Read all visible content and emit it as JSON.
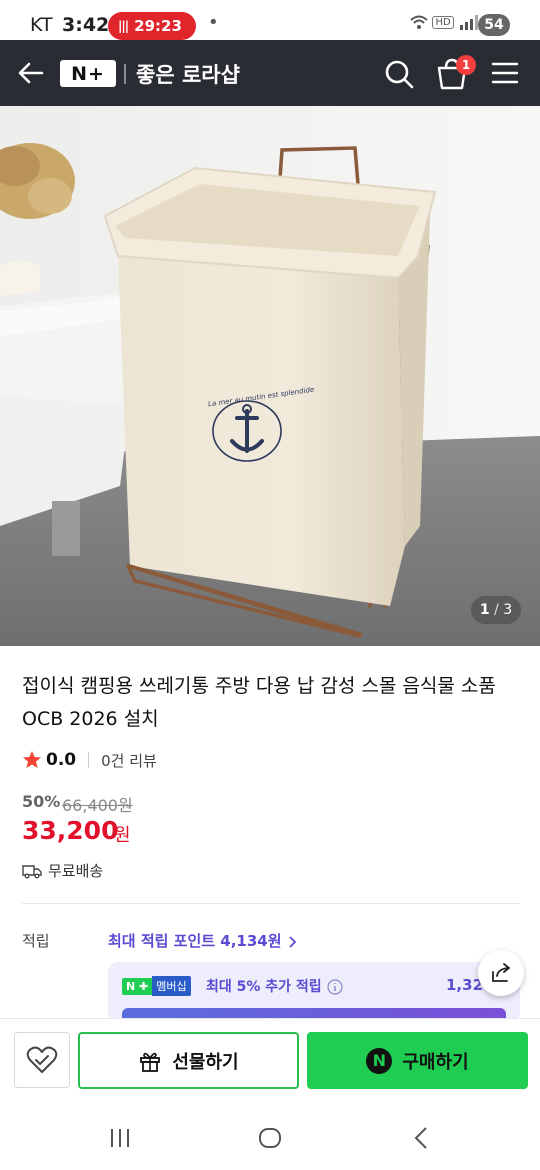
{
  "status_bar": {
    "carrier": "KT",
    "time": "3:42",
    "recording_time": "29:23",
    "dot": "•",
    "network": "HD",
    "battery": "54"
  },
  "header": {
    "logo": "N+",
    "store_name": "좋은 로라샵",
    "cart_count": "1"
  },
  "product": {
    "image_counter": {
      "current": "1",
      "total": "3"
    },
    "title": "접이식 캠핑용 쓰레기통 주방 다용 납 감성 스몰 음식물 소품 OCB 2026 설치",
    "rating": "0.0",
    "review_count": "0건 리뷰",
    "discount_rate": "50%",
    "original_price": "66,400원",
    "sale_price": "33,200",
    "price_unit": "원",
    "shipping": "무료배송",
    "bag_print": "La mer au mutin est splendide"
  },
  "points": {
    "label": "적립",
    "max_points": "최대 적립 포인트 4,134원",
    "membership_badge": "멤버십",
    "membership_text": "최대 5% 추가 적립",
    "membership_amount": "1,32"
  },
  "actions": {
    "gift_label": "선물하기",
    "buy_label": "구매하기",
    "npay_logo": "N"
  },
  "colors": {
    "header_bg": "#2a2c33",
    "sale_red": "#e1112b",
    "npay_green": "#1ecd51",
    "points_purple": "#5a4bd1"
  }
}
